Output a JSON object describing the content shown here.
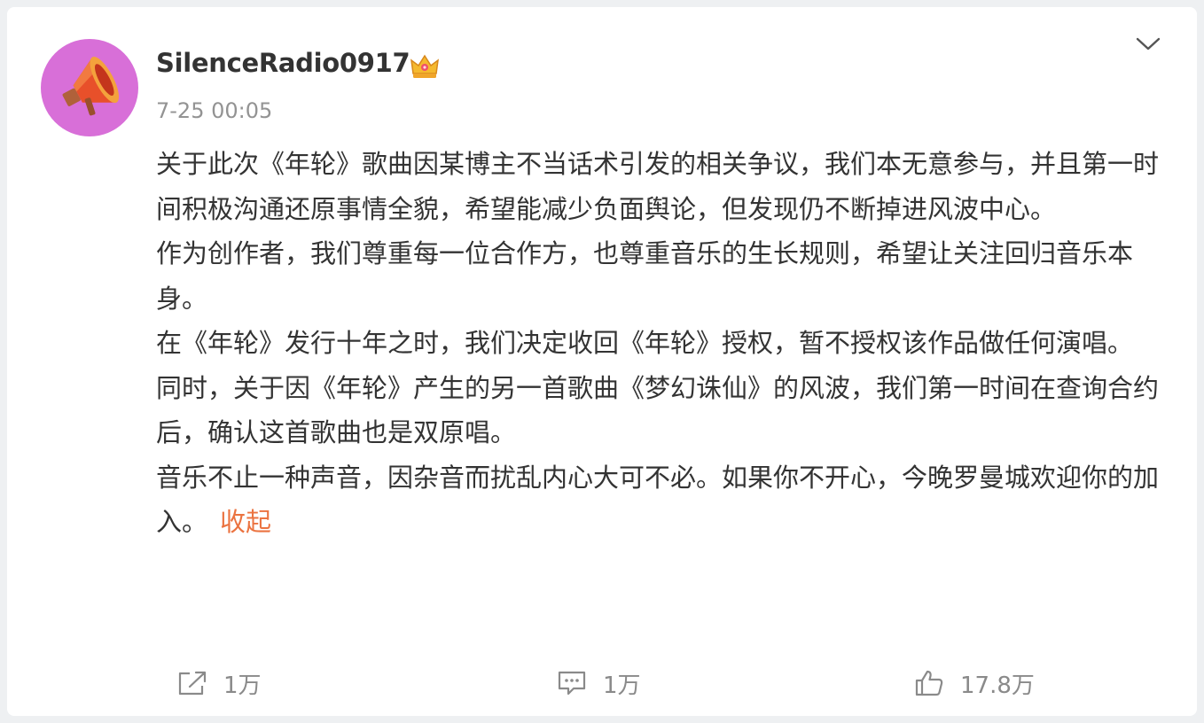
{
  "post": {
    "username": "SilenceRadio0917",
    "user_badge_icon": "crown-icon",
    "avatar_icon": "megaphone-icon",
    "timestamp": "7-25 00:05",
    "paragraphs": [
      "关于此次《年轮》歌曲因某博主不当话术引发的相关争议，我们本无意参与，并且第一时间积极沟通还原事情全貌，希望能减少负面舆论，但发现仍不断掉进风波中心。",
      "作为创作者，我们尊重每一位合作方，也尊重音乐的生长规则，希望让关注回归音乐本身。",
      "在《年轮》发行十年之时，我们决定收回《年轮》授权，暂不授权该作品做任何演唱。",
      "同时，关于因《年轮》产生的另一首歌曲《梦幻诛仙》的风波，我们第一时间在查询合约后，确认这首歌曲也是双原唱。",
      "音乐不止一种声音，因杂音而扰乱内心大可不必。如果你不开心，今晚罗曼城欢迎你的加入。"
    ],
    "collapse_label": "收起"
  },
  "actions": {
    "repost": {
      "icon": "share-icon",
      "count": "1万"
    },
    "comment": {
      "icon": "comment-icon",
      "count": "1万"
    },
    "like": {
      "icon": "thumbs-up-icon",
      "count": "17.8万"
    }
  },
  "colors": {
    "accent_link": "#eb7340",
    "avatar_bg": "#d86fd8",
    "muted_text": "#939393"
  }
}
